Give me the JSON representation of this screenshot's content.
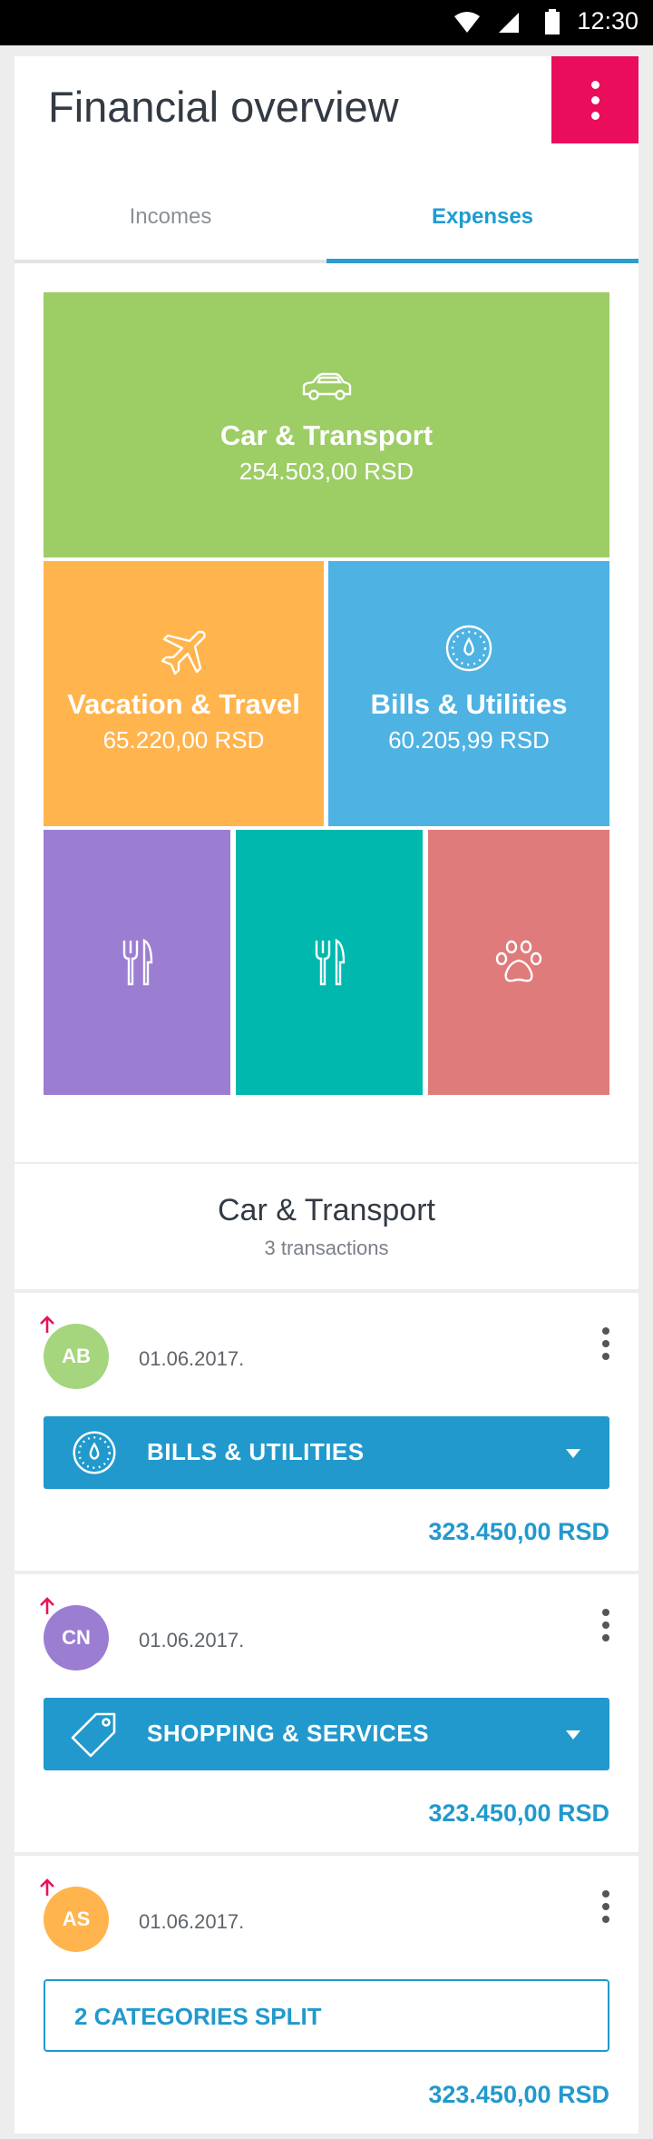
{
  "status_bar": {
    "time": "12:30"
  },
  "header": {
    "title": "Financial overview"
  },
  "tabs": [
    {
      "label": "Incomes",
      "active": false
    },
    {
      "label": "Expenses",
      "active": true
    }
  ],
  "treemap": {
    "car": {
      "name": "Car & Transport",
      "amount": "254.503,00 RSD",
      "icon": "car-icon",
      "color": "#9dcd65"
    },
    "vacation": {
      "name": "Vacation & Travel",
      "amount": "65.220,00 RSD",
      "icon": "airplane-icon",
      "color": "#ffb44d"
    },
    "bills": {
      "name": "Bills & Utilities",
      "amount": "60.205,99 RSD",
      "icon": "gauge-icon",
      "color": "#4eb2e3"
    },
    "small": [
      {
        "icon": "fork-knife-icon",
        "color": "#9b7ed2"
      },
      {
        "icon": "fork-knife-icon",
        "color": "#00b8ae"
      },
      {
        "icon": "paw-icon",
        "color": "#e07b7b"
      }
    ]
  },
  "section": {
    "title": "Car & Transport",
    "subtitle": "3 transactions"
  },
  "transactions": [
    {
      "initials": "AB",
      "avatar_color": "#a5d57c",
      "date": "01.06.2017.",
      "category": "BILLS & UTILITIES",
      "category_icon": "gauge-icon",
      "amount": "323.450,00 RSD"
    },
    {
      "initials": "CN",
      "avatar_color": "#9b7ed2",
      "date": "01.06.2017.",
      "category": "SHOPPING & SERVICES",
      "category_icon": "tag-icon",
      "amount": "323.450,00 RSD"
    },
    {
      "initials": "AS",
      "avatar_color": "#ffb44d",
      "date": "01.06.2017.",
      "category": "2 CATEGORIES SPLIT",
      "category_icon": "",
      "amount": "323.450,00 RSD"
    }
  ],
  "colors": {
    "accent": "#2199cd",
    "menu": "#ea0d5b"
  }
}
